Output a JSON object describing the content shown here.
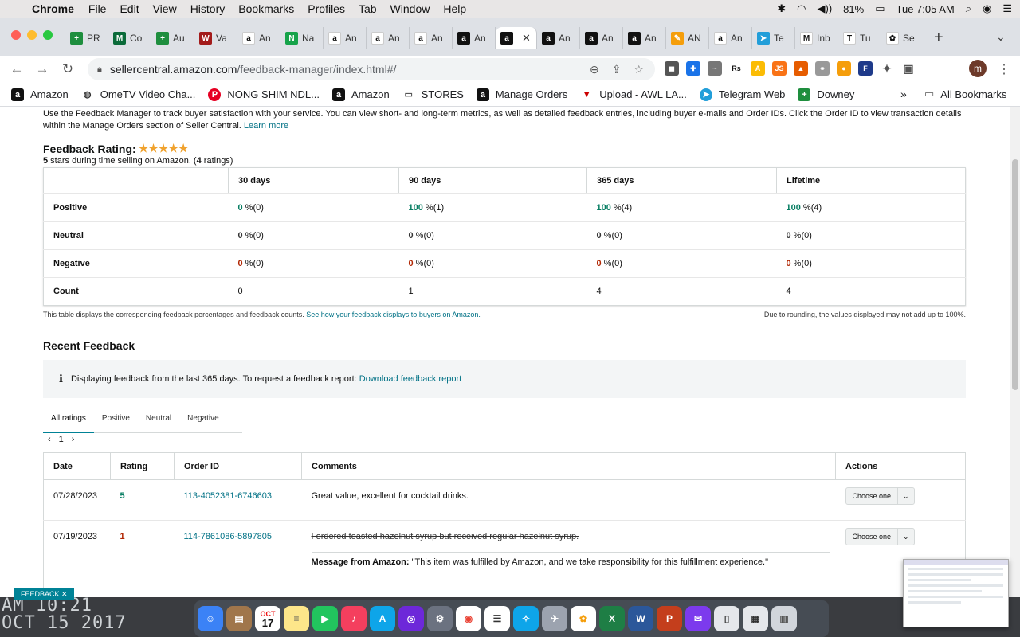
{
  "menubar": {
    "app": "Chrome",
    "items": [
      "File",
      "Edit",
      "View",
      "History",
      "Bookmarks",
      "Profiles",
      "Tab",
      "Window",
      "Help"
    ],
    "battery": "81%",
    "clock": "Tue 7:05 AM"
  },
  "tabs": [
    {
      "label": "PR",
      "color": "#1e8e3e",
      "glyph": "+"
    },
    {
      "label": "Co",
      "color": "#0b6b3a",
      "glyph": "M"
    },
    {
      "label": "Au",
      "color": "#1e8e3e",
      "glyph": "+"
    },
    {
      "label": "Va",
      "color": "#a31b1b",
      "glyph": "W"
    },
    {
      "label": "An",
      "color": "#ffffff",
      "glyph": "a"
    },
    {
      "label": "Na",
      "color": "#16a34a",
      "glyph": "N"
    },
    {
      "label": "An",
      "color": "#ffffff",
      "glyph": "a"
    },
    {
      "label": "An",
      "color": "#ffffff",
      "glyph": "a"
    },
    {
      "label": "An",
      "color": "#ffffff",
      "glyph": "a"
    },
    {
      "label": "An",
      "color": "#111111",
      "glyph": "a"
    },
    {
      "label": "",
      "color": "#111111",
      "glyph": "a",
      "active": true
    },
    {
      "label": "An",
      "color": "#111111",
      "glyph": "a"
    },
    {
      "label": "An",
      "color": "#111111",
      "glyph": "a"
    },
    {
      "label": "An",
      "color": "#111111",
      "glyph": "a"
    },
    {
      "label": "AN",
      "color": "#f59e0b",
      "glyph": "✎"
    },
    {
      "label": "An",
      "color": "#ffffff",
      "glyph": "a"
    },
    {
      "label": "Te",
      "color": "#229ed9",
      "glyph": "➤"
    },
    {
      "label": "Inb",
      "color": "#ffffff",
      "glyph": "M"
    },
    {
      "label": "Tu",
      "color": "#ffffff",
      "glyph": "T"
    },
    {
      "label": "Se",
      "color": "#ffffff",
      "glyph": "✿"
    }
  ],
  "url": {
    "host": "sellercentral.amazon.com",
    "path": "/feedback-manager/index.html#/"
  },
  "bookmarks": [
    "Amazon",
    "OmeTV Video Cha...",
    "NONG SHIM NDL...",
    "Amazon",
    "STORES",
    "Manage Orders",
    "Upload - AWL LA...",
    "Telegram Web",
    "Downey"
  ],
  "bookmarks_all": "All Bookmarks",
  "intro": {
    "text": "Use the Feedback Manager to track buyer satisfaction with your service. You can view short- and long-term metrics, as well as detailed feedback entries, including buyer e-mails and Order IDs. Click the Order ID to view transaction details within the Manage Orders section of Seller Central.",
    "link": "Learn more"
  },
  "rating": {
    "title": "Feedback Rating:",
    "stars": 5,
    "sub_stars": "5",
    "sub_mid": " stars during time selling on Amazon. (",
    "sub_count": "4",
    "sub_end": " ratings)"
  },
  "ftable": {
    "headers": [
      "30 days",
      "90 days",
      "365 days",
      "Lifetime"
    ],
    "rows": [
      {
        "label": "Positive",
        "kind": "pos",
        "cells": [
          [
            "0",
            " %(0)"
          ],
          [
            "100",
            " %(1)"
          ],
          [
            "100",
            " %(4)"
          ],
          [
            "100",
            " %(4)"
          ]
        ]
      },
      {
        "label": "Neutral",
        "kind": "neu",
        "cells": [
          [
            "0",
            " %(0)"
          ],
          [
            "0",
            " %(0)"
          ],
          [
            "0",
            " %(0)"
          ],
          [
            "0",
            " %(0)"
          ]
        ]
      },
      {
        "label": "Negative",
        "kind": "neg",
        "cells": [
          [
            "0",
            " %(0)"
          ],
          [
            "0",
            " %(0)"
          ],
          [
            "0",
            " %(0)"
          ],
          [
            "0",
            " %(0)"
          ]
        ]
      },
      {
        "label": "Count",
        "kind": "plain",
        "cells": [
          [
            "",
            "0"
          ],
          [
            "",
            "1"
          ],
          [
            "",
            "4"
          ],
          [
            "",
            "4"
          ]
        ]
      }
    ],
    "note_left": "This table displays the corresponding feedback percentages and feedback counts.",
    "note_link": "See how your feedback displays to buyers on Amazon.",
    "note_right": "Due to rounding, the values displayed may not add up to 100%."
  },
  "recent": {
    "title": "Recent Feedback",
    "info": "Displaying feedback from the last 365 days. To request a feedback report:",
    "info_link": "Download feedback report",
    "tabs": [
      "All ratings",
      "Positive",
      "Neutral",
      "Negative"
    ],
    "page": "1",
    "headers": [
      "Date",
      "Rating",
      "Order ID",
      "Comments",
      "Actions"
    ],
    "rows": [
      {
        "date": "07/28/2023",
        "rating": "5",
        "kind": "pos",
        "order": "113-4052381-6746603",
        "comment": "Great value, excellent for cocktail drinks.",
        "struck": false,
        "action": "Choose one"
      },
      {
        "date": "07/19/2023",
        "rating": "1",
        "kind": "neg",
        "order": "114-7861086-5897805",
        "comment": "I ordered toasted hazelnut syrup but received regular hazelnut syrup.",
        "struck": true,
        "action": "Choose one",
        "amz_label": "Message from Amazon:",
        "amz_text": " \"This item was fulfilled by Amazon, and we take responsibility for this fulfillment experience.\""
      }
    ]
  },
  "feedback_tab": "FEEDBACK",
  "wallpaper": {
    "line1": "AM 10:21",
    "line2": "OCT 15 2017"
  },
  "calendar": {
    "month": "OCT",
    "day": "17"
  },
  "colors": {
    "positive": "#067d62",
    "negative": "#b12704",
    "link": "#007185",
    "accent": "#008296"
  }
}
